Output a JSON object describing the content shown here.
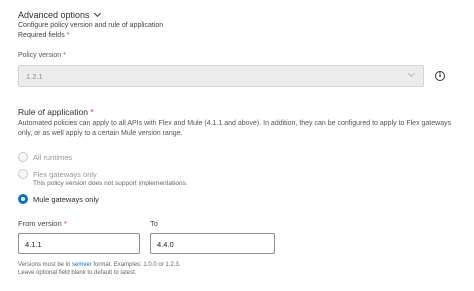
{
  "advanced": {
    "title": "Advanced options",
    "description": "Configure policy version and rule of application",
    "required_text": "Required fields",
    "asterisk": "*"
  },
  "policy_version": {
    "label": "Policy version",
    "value": "1.2.1"
  },
  "rule": {
    "title": "Rule of application",
    "description": "Automated policies can apply to all APIs with Flex and Mule (4.1.1 and above). In addition, they can be configured to apply to Flex gateways only, or as well apply to a certain Mule version range.",
    "options": [
      {
        "label": "All runtimes",
        "sublabel": "",
        "selected": false
      },
      {
        "label": "Flex gateways only",
        "sublabel": "This policy version does not support implementations.",
        "selected": false
      },
      {
        "label": "Mule gateways only",
        "sublabel": "",
        "selected": true
      }
    ]
  },
  "version_range": {
    "from_label": "From version",
    "from_value": "4.1.1",
    "to_label": "To",
    "to_value": "4.4.0"
  },
  "hint": {
    "line1_prefix": "Versions must be in ",
    "line1_link": "semver",
    "line1_suffix": " format. Examples: 1.0.0 or 1.2.3.",
    "line2": "Leave optional field blank to default to latest."
  },
  "colors": {
    "accent": "#0b6fd0",
    "required": "#d0362b"
  }
}
